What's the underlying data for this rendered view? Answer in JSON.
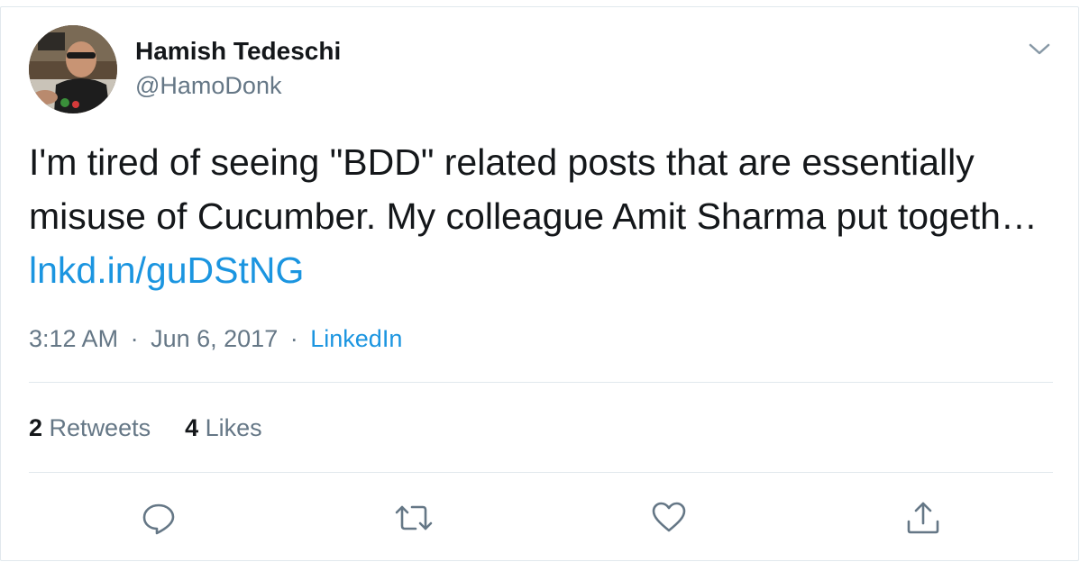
{
  "author": {
    "display_name": "Hamish Tedeschi",
    "handle": "@HamoDonk"
  },
  "tweet": {
    "text": "I'm tired of seeing \"BDD\" related posts that are essentially misuse of Cucumber. My colleague Amit Sharma put togeth…",
    "link_text": "lnkd.in/guDStNG"
  },
  "meta": {
    "time": "3:12 AM",
    "separator": "·",
    "date": "Jun 6, 2017",
    "source": "LinkedIn"
  },
  "stats": {
    "retweets_count": "2",
    "retweets_label": "Retweets",
    "likes_count": "4",
    "likes_label": "Likes"
  },
  "actions": {
    "reply_icon": "reply-icon",
    "retweet_icon": "retweet-icon",
    "like_icon": "heart-icon",
    "share_icon": "share-icon"
  },
  "colors": {
    "link": "#1b95e0",
    "secondary_text": "#657786",
    "primary_text": "#14171a",
    "divider": "#e1e8ed"
  }
}
